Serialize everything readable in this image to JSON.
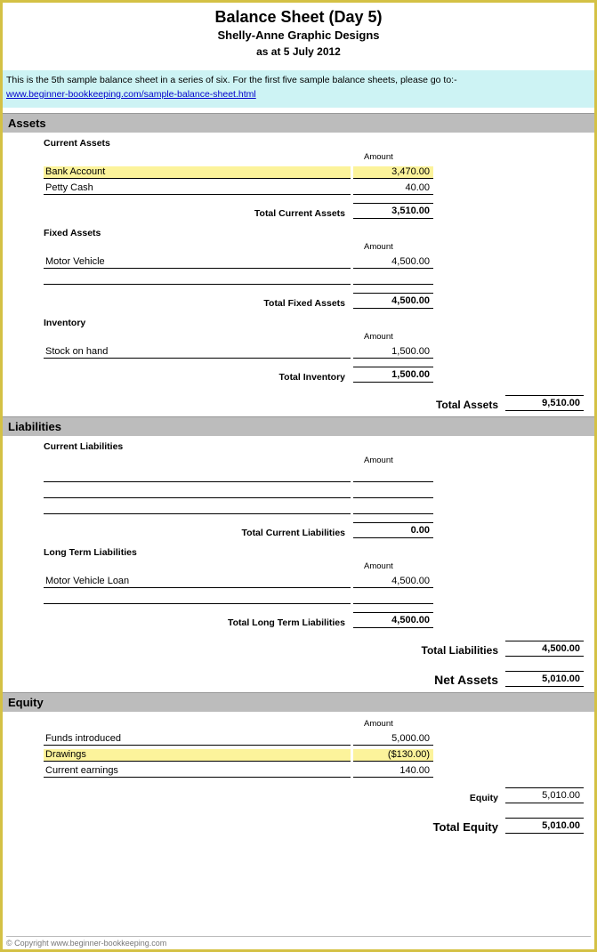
{
  "header": {
    "title": "Balance Sheet (Day 5)",
    "subtitle": "Shelly-Anne Graphic Designs",
    "date": "as at 5 July 2012"
  },
  "notice": {
    "text": "This is the 5th sample balance sheet in a series of six. For the first five sample balance sheets, please go to:-",
    "link": "www.beginner-bookkeeping.com/sample-balance-sheet.html"
  },
  "sections": {
    "assets": {
      "heading": "Assets",
      "current": {
        "heading": "Current Assets",
        "amount_heading": "Amount",
        "items": [
          {
            "label": "Bank Account",
            "value": "3,470.00",
            "highlight": true
          },
          {
            "label": "Petty Cash",
            "value": "40.00"
          }
        ],
        "total_label": "Total Current Assets",
        "total_value": "3,510.00"
      },
      "fixed": {
        "heading": "Fixed Assets",
        "amount_heading": "Amount",
        "items": [
          {
            "label": "Motor Vehicle",
            "value": "4,500.00"
          },
          {
            "label": "",
            "value": ""
          }
        ],
        "total_label": "Total Fixed Assets",
        "total_value": "4,500.00"
      },
      "inventory": {
        "heading": "Inventory",
        "amount_heading": "Amount",
        "items": [
          {
            "label": "Stock on hand",
            "value": "1,500.00"
          }
        ],
        "total_label": "Total Inventory",
        "total_value": "1,500.00"
      },
      "grand_label": "Total Assets",
      "grand_value": "9,510.00"
    },
    "liabilities": {
      "heading": "Liabilities",
      "current": {
        "heading": "Current Liabilities",
        "amount_heading": "Amount",
        "items": [
          {
            "label": "",
            "value": ""
          },
          {
            "label": "",
            "value": ""
          },
          {
            "label": "",
            "value": ""
          }
        ],
        "total_label": "Total Current Liabilities",
        "total_value": "0.00"
      },
      "longterm": {
        "heading": "Long Term Liabilities",
        "amount_heading": "Amount",
        "items": [
          {
            "label": "Motor Vehicle Loan",
            "value": "4,500.00"
          },
          {
            "label": "",
            "value": ""
          }
        ],
        "total_label": "Total Long Term Liabilities",
        "total_value": "4,500.00"
      },
      "grand_label": "Total Liabilities",
      "grand_value": "4,500.00",
      "net_label": "Net Assets",
      "net_value": "5,010.00"
    },
    "equity": {
      "heading": "Equity",
      "amount_heading": "Amount",
      "items": [
        {
          "label": "Funds introduced",
          "value": "5,000.00"
        },
        {
          "label": "Drawings",
          "value": "($130.00)",
          "highlight": true
        },
        {
          "label": "Current earnings",
          "value": "140.00"
        }
      ],
      "sub_label": "Equity",
      "sub_value": "5,010.00",
      "grand_label": "Total Equity",
      "grand_value": "5,010.00"
    }
  },
  "copyright": "© Copyright   www.beginner-bookkeeping.com"
}
